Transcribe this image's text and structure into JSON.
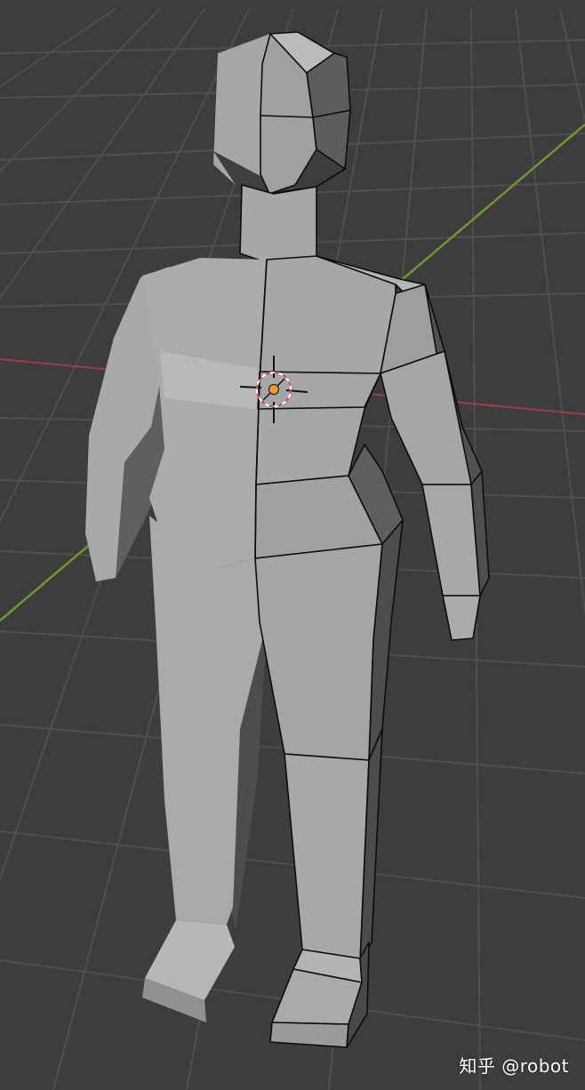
{
  "watermark": {
    "text": "知乎 @robot"
  },
  "colors": {
    "background": "#3d3d3d",
    "grid_line": "#4f4f4f",
    "axis_x": "#9b3c48",
    "axis_y": "#6e9a2d",
    "mesh_face": "#a9abac",
    "mesh_face_light": "#b6b8b9",
    "mesh_face_dark": "#6d6f70",
    "mesh_edge": "#0d0d0d",
    "origin_dot": "#f29e1f",
    "cursor_ring_red": "#d9404a",
    "cursor_ring_white": "#ffffff"
  }
}
